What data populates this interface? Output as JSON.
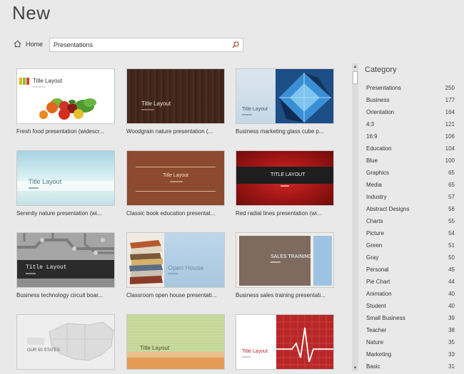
{
  "header": {
    "title": "New"
  },
  "nav": {
    "home_label": "Home"
  },
  "search": {
    "value": "Presentations"
  },
  "templates": [
    {
      "label": "Fresh food presentation (widescr...",
      "thumb_title": "Title Layout"
    },
    {
      "label": "Woodgrain nature presentation (...",
      "thumb_title": "Title Layout"
    },
    {
      "label": "Business marketing glass cube p...",
      "thumb_title": "Title Layout"
    },
    {
      "label": "Serenity nature presentation (wi...",
      "thumb_title": "Title Layout"
    },
    {
      "label": "Classic book education presentat...",
      "thumb_title": "Title Layout"
    },
    {
      "label": "Red radial lines presentation (wi...",
      "thumb_title": "TITLE LAYOUT"
    },
    {
      "label": "Business technology circuit boar...",
      "thumb_title": "Title Layout"
    },
    {
      "label": "Classroom open house presentati...",
      "thumb_title": "Open House"
    },
    {
      "label": "Business sales training presentati...",
      "thumb_title": "SALES TRAINING"
    },
    {
      "label": "",
      "thumb_title": "OUR 50 STATES"
    },
    {
      "label": "",
      "thumb_title": "Title Layout"
    },
    {
      "label": "",
      "thumb_title": "Title Layout"
    }
  ],
  "sidebar": {
    "title": "Category",
    "categories": [
      {
        "name": "Presentations",
        "count": "250"
      },
      {
        "name": "Business",
        "count": "177"
      },
      {
        "name": "Orientation",
        "count": "164"
      },
      {
        "name": "4:3",
        "count": "121"
      },
      {
        "name": "16:9",
        "count": "106"
      },
      {
        "name": "Education",
        "count": "104"
      },
      {
        "name": "Blue",
        "count": "100"
      },
      {
        "name": "Graphics",
        "count": "65"
      },
      {
        "name": "Media",
        "count": "65"
      },
      {
        "name": "Industry",
        "count": "57"
      },
      {
        "name": "Abstract Designs",
        "count": "56"
      },
      {
        "name": "Charts",
        "count": "55"
      },
      {
        "name": "Picture",
        "count": "54"
      },
      {
        "name": "Green",
        "count": "51"
      },
      {
        "name": "Gray",
        "count": "50"
      },
      {
        "name": "Personal",
        "count": "45"
      },
      {
        "name": "Pie Chart",
        "count": "44"
      },
      {
        "name": "Animation",
        "count": "40"
      },
      {
        "name": "Student",
        "count": "40"
      },
      {
        "name": "Small Business",
        "count": "39"
      },
      {
        "name": "Teacher",
        "count": "38"
      },
      {
        "name": "Nature",
        "count": "35"
      },
      {
        "name": "Marketing",
        "count": "33"
      },
      {
        "name": "Basic",
        "count": "31"
      }
    ]
  }
}
